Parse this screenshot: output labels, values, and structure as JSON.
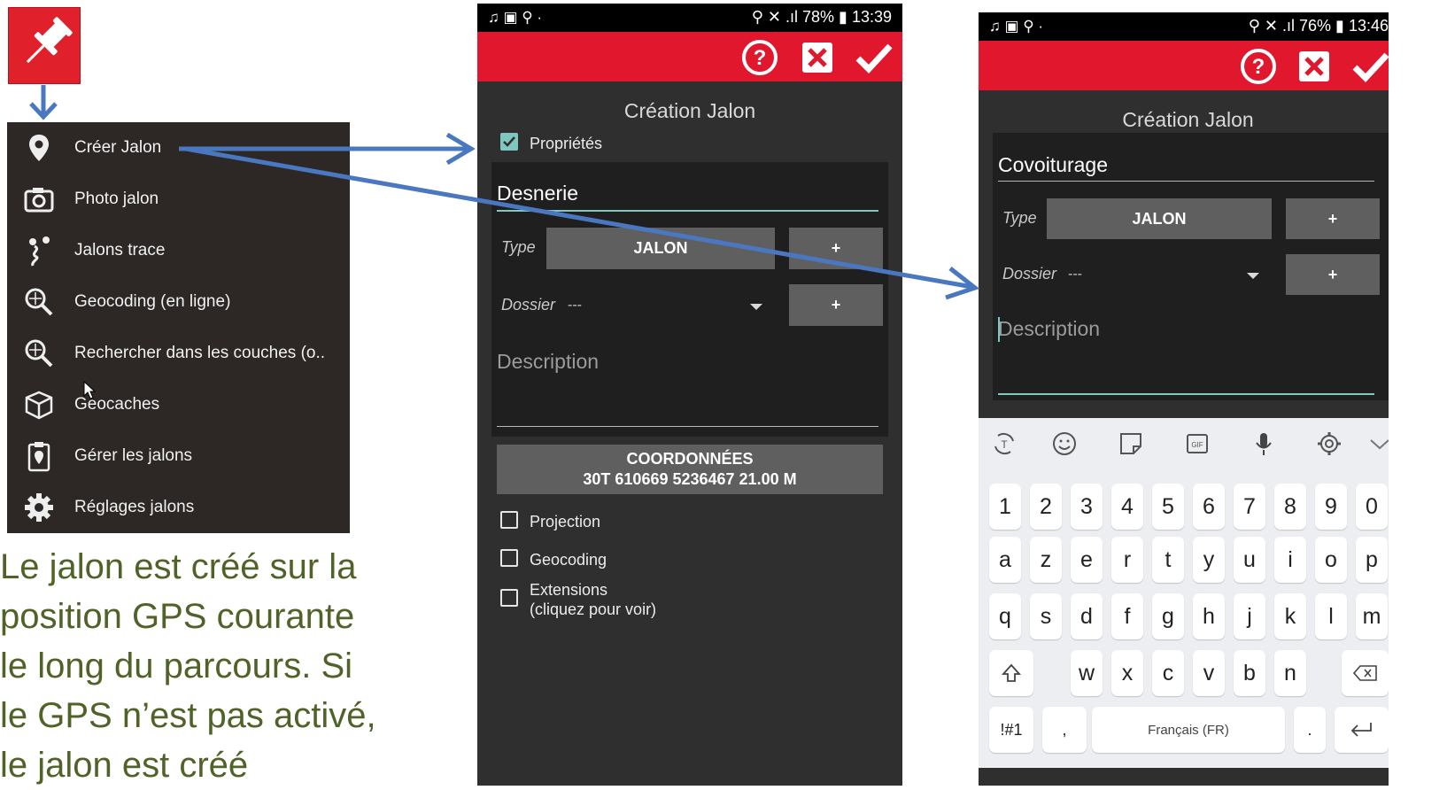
{
  "menu": {
    "items": [
      {
        "label": "Créer Jalon",
        "icon": "pin-icon"
      },
      {
        "label": "Photo jalon",
        "icon": "camera-icon"
      },
      {
        "label": "Jalons trace",
        "icon": "route-icon"
      },
      {
        "label": "Geocoding (en ligne)",
        "icon": "search-globe-icon"
      },
      {
        "label": "Rechercher dans les couches (o..",
        "icon": "search-layers-icon"
      },
      {
        "label": "Geocaches",
        "icon": "box-icon"
      },
      {
        "label": "Gérer les jalons",
        "icon": "clipboard-pin-icon"
      },
      {
        "label": "Réglages jalons",
        "icon": "gear-icon"
      }
    ]
  },
  "caption": {
    "lines": [
      "Le jalon est créé sur la",
      "position GPS courante",
      "le long du parcours. Si",
      "le GPS n’est pas activé,",
      "le jalon est créé"
    ]
  },
  "phone1": {
    "status_battery": "78%",
    "status_time": "13:39",
    "title": "Création Jalon",
    "properties_label": "Propriétés",
    "properties_checked": true,
    "name_value": "Desnerie",
    "type_label": "Type",
    "type_value": "JALON",
    "plus_label": "+",
    "folder_label": "Dossier",
    "folder_value": "---",
    "description_placeholder": "Description",
    "coords_title": "COORDONNÉES",
    "coords_value": "30T 610669 5236467 21.00 M",
    "options": [
      {
        "label": "Projection",
        "checked": false
      },
      {
        "label": "Geocoding",
        "checked": false
      },
      {
        "label": "Extensions",
        "sublabel": "(cliquez pour voir)",
        "checked": false
      }
    ]
  },
  "phone2": {
    "status_battery": "76%",
    "status_time": "13:46",
    "title": "Création Jalon",
    "name_value": "Covoiturage",
    "type_label": "Type",
    "type_value": "JALON",
    "plus_label": "+",
    "folder_label": "Dossier",
    "folder_value": "---",
    "description_placeholder": "Description"
  },
  "keyboard": {
    "row_numbers": [
      "1",
      "2",
      "3",
      "4",
      "5",
      "6",
      "7",
      "8",
      "9",
      "0"
    ],
    "row1": [
      "a",
      "z",
      "e",
      "r",
      "t",
      "y",
      "u",
      "i",
      "o",
      "p"
    ],
    "row2": [
      "q",
      "s",
      "d",
      "f",
      "g",
      "h",
      "j",
      "k",
      "l",
      "m"
    ],
    "row3": [
      "w",
      "x",
      "c",
      "v",
      "b",
      "n"
    ],
    "symbols_key": "!#1",
    "comma_key": ",",
    "space_label": "Français (FR)",
    "period_key": "."
  },
  "colors": {
    "toolbar_red": "#e1172d",
    "accent_teal": "#7fc8c0",
    "arrow_blue": "#4a78c0",
    "caption_green": "#4f6228"
  }
}
